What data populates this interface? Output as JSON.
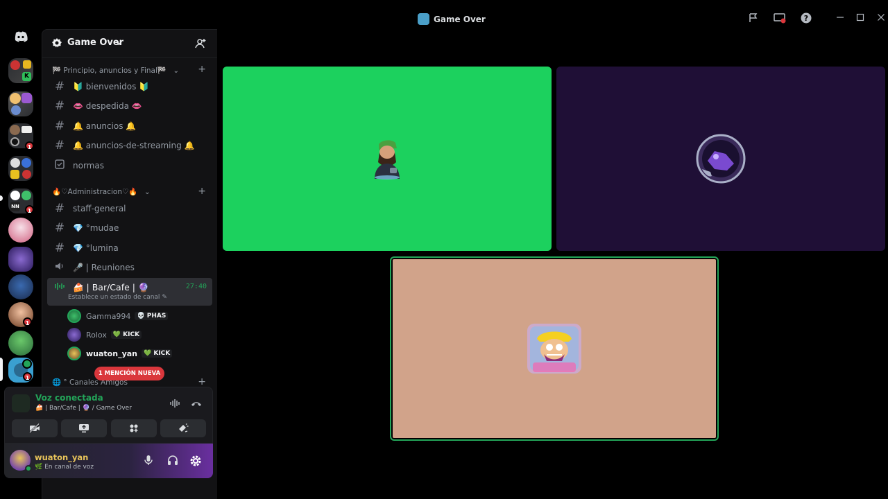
{
  "window": {
    "title": "Game Over",
    "controls": [
      "inbox-icon",
      "screen-share-icon",
      "help-icon",
      "minimize-icon",
      "maximize-icon",
      "close-icon"
    ]
  },
  "rail": {
    "servers": [
      {
        "name": "discord-home",
        "badge": ""
      },
      {
        "name": "server-1",
        "badge": ""
      },
      {
        "name": "server-2",
        "badge": ""
      },
      {
        "name": "server-3",
        "badge": "1"
      },
      {
        "name": "server-4",
        "badge": ""
      },
      {
        "name": "server-5",
        "badge": "1"
      },
      {
        "name": "server-6",
        "badge": ""
      },
      {
        "name": "server-7",
        "badge": ""
      },
      {
        "name": "server-8",
        "badge": ""
      },
      {
        "name": "server-9",
        "badge": "1"
      },
      {
        "name": "server-10",
        "badge": ""
      },
      {
        "name": "server-game-over",
        "badge": "1"
      }
    ]
  },
  "guild": {
    "name": "Game Over"
  },
  "categories": [
    {
      "label": "🏁 Principio, anuncios y Final🏁"
    },
    {
      "label": "🔥♡Administracion♡🔥"
    },
    {
      "label": "🌐 ° Canales Amigos"
    }
  ],
  "channels": [
    {
      "label": "🔰 bienvenidos 🔰",
      "type": "text"
    },
    {
      "label": "👄 despedida 👄",
      "type": "text"
    },
    {
      "label": "🔔 anuncios 🔔",
      "type": "text"
    },
    {
      "label": "🔔 anuncios-de-streaming 🔔",
      "type": "text"
    },
    {
      "label": "normas",
      "type": "rules"
    },
    {
      "label": "staff-general",
      "type": "text"
    },
    {
      "label": "💎 °mudae",
      "type": "text"
    },
    {
      "label": "💎 °lumina",
      "type": "text"
    },
    {
      "label": "🎤 | Reuniones",
      "type": "voice"
    }
  ],
  "active_channel": {
    "label": "🍰 | Bar/Cafe | 🔮",
    "timer": "27:40",
    "status": "Establece un estado de canal"
  },
  "voice_users": [
    {
      "name": "Gamma994",
      "tag": "💀 PHAS"
    },
    {
      "name": "Rolox",
      "tag": "💚 KICK"
    },
    {
      "name": "wuaton_yan",
      "tag": "💚 KICK"
    }
  ],
  "mention_pill": "1 MENCIÓN NUEVA",
  "voice_panel": {
    "title": "Voz conectada",
    "subtitle": "🍰 | Bar/Cafe | 🔮 / Game Over"
  },
  "user": {
    "name": "wuaton_yan",
    "status": "🌿 En canal de voz"
  },
  "tiles": [
    {
      "name": "gamma994-tile",
      "bg": "#1cd15e"
    },
    {
      "name": "rolox-tile",
      "bg": "#1f0f36"
    },
    {
      "name": "wuaton-yan-tile",
      "bg": "#d1a38a",
      "speaking": true
    }
  ]
}
